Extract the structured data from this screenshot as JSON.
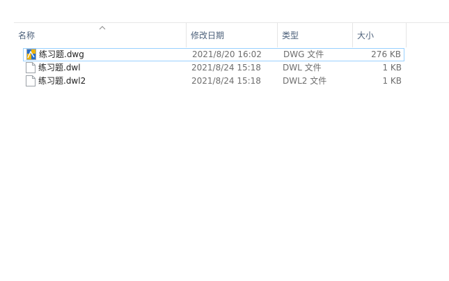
{
  "columns": {
    "name": "名称",
    "date": "修改日期",
    "type": "类型",
    "size": "大小"
  },
  "sort": {
    "column": "name",
    "direction": "ascending",
    "icon": "chevron-up-icon"
  },
  "files": [
    {
      "name": "练习题.dwg",
      "date": "2021/8/20 16:02",
      "type": "DWG 文件",
      "size": "276 KB",
      "icon": "dwg-file-icon",
      "selected": true
    },
    {
      "name": "练习题.dwl",
      "date": "2021/8/24 15:18",
      "type": "DWL 文件",
      "size": "1 KB",
      "icon": "blank-file-icon",
      "selected": false
    },
    {
      "name": "练习题.dwl2",
      "date": "2021/8/24 15:18",
      "type": "DWL2 文件",
      "size": "1 KB",
      "icon": "blank-file-icon",
      "selected": false
    }
  ],
  "colors": {
    "header_text": "#4c607a",
    "selection_border": "#99d1ff",
    "secondary_text": "#6d6d6d"
  }
}
